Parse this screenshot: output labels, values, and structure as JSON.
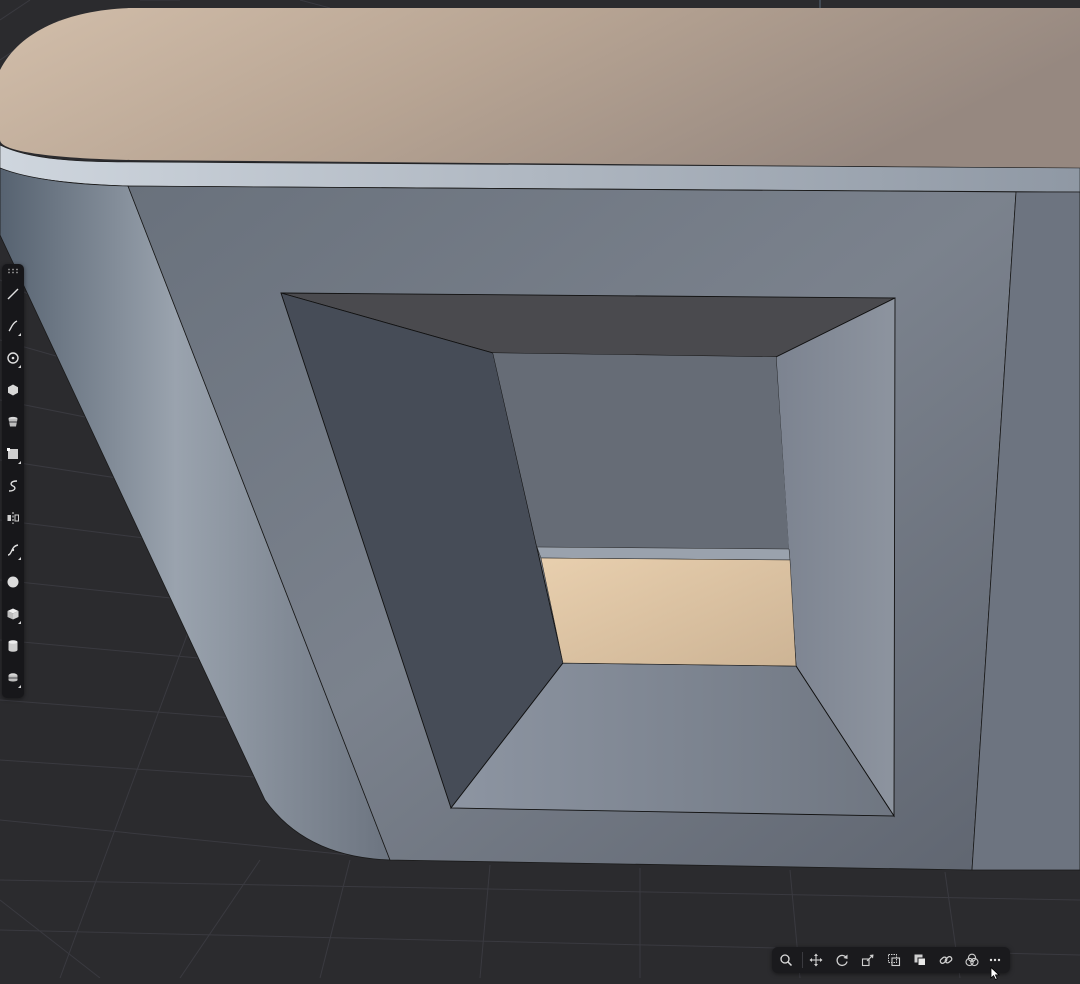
{
  "viewport": {
    "background_color": "#2b2b2e",
    "grid_color": "#3a3a40",
    "model_top_color": "#b9a796",
    "model_side_color": "#7d848e",
    "model_inner_floor_color": "#d9c2a3",
    "edge_color": "#111111"
  },
  "tool_palette": {
    "grip_icon": "grip-dots-icon",
    "tools": [
      {
        "name": "line-tool",
        "icon": "line-icon",
        "has_submenu": false
      },
      {
        "name": "arc-tool",
        "icon": "arc-icon",
        "has_submenu": true
      },
      {
        "name": "circle-tool",
        "icon": "circle-icon",
        "has_submenu": true
      },
      {
        "name": "polygon-tool",
        "icon": "hexagon-icon",
        "has_submenu": false
      },
      {
        "name": "cylinder-profile-tool",
        "icon": "cup-icon",
        "has_submenu": false
      },
      {
        "name": "rectangle-tool",
        "icon": "rectangle-icon",
        "has_submenu": true
      },
      {
        "name": "freehand-curve-tool",
        "icon": "s-curve-icon",
        "has_submenu": false
      },
      {
        "name": "mirror-tool",
        "icon": "mirror-icon",
        "has_submenu": false
      },
      {
        "name": "spline-tool",
        "icon": "spline-icon",
        "has_submenu": true
      },
      {
        "name": "sphere-tool",
        "icon": "sphere-icon",
        "has_submenu": false
      },
      {
        "name": "box-tool",
        "icon": "cube-icon",
        "has_submenu": true
      },
      {
        "name": "cylinder-tool",
        "icon": "cylinder-icon",
        "has_submenu": false
      },
      {
        "name": "material-tool",
        "icon": "bucket-icon",
        "has_submenu": true
      }
    ]
  },
  "bottom_toolbar": {
    "buttons": [
      {
        "name": "zoom-button",
        "icon": "magnifier-icon"
      },
      {
        "name": "move-button",
        "icon": "move-arrows-icon"
      },
      {
        "name": "rotate-button",
        "icon": "rotate-icon"
      },
      {
        "name": "scale-button",
        "icon": "scale-icon"
      },
      {
        "name": "duplicate-button",
        "icon": "duplicate-icon"
      },
      {
        "name": "copy-button",
        "icon": "copy-stack-icon"
      },
      {
        "name": "link-button",
        "icon": "link-icon"
      },
      {
        "name": "boolean-button",
        "icon": "boolean-circles-icon"
      },
      {
        "name": "more-button",
        "icon": "ellipsis-icon"
      }
    ]
  }
}
